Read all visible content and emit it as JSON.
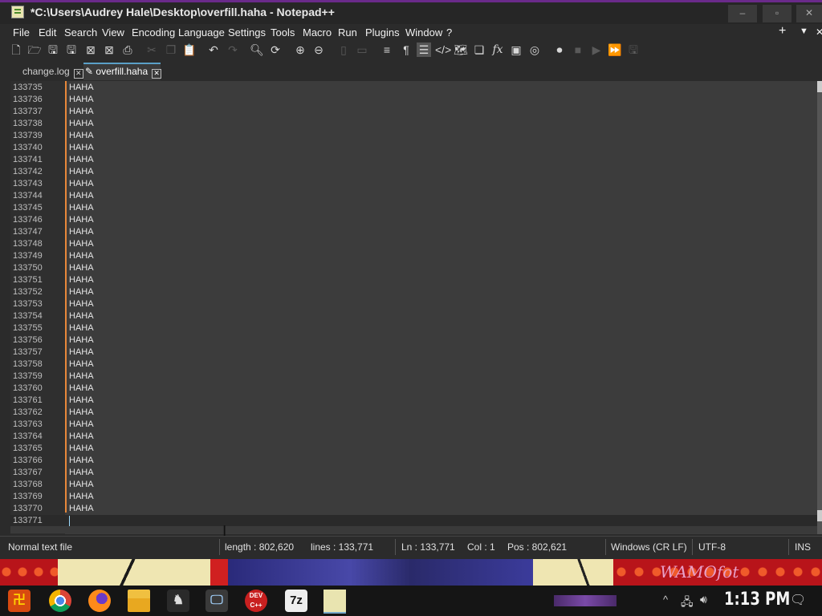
{
  "window": {
    "title": "*C:\\Users\\Audrey Hale\\Desktop\\overfill.haha - Notepad++",
    "controls": {
      "minimize": "–",
      "maximize": "▫",
      "close": "✕"
    }
  },
  "menubar": {
    "items": [
      "File",
      "Edit",
      "Search",
      "View",
      "Encoding",
      "Language",
      "Settings",
      "Tools",
      "Macro",
      "Run",
      "Plugins",
      "Window",
      "?"
    ],
    "right_buttons": {
      "add": "+",
      "list": "▼",
      "close": "✕"
    }
  },
  "toolbar": {
    "icons": [
      "new-file-icon",
      "open-file-icon",
      "save-icon",
      "save-all-icon",
      "close-icon",
      "close-all-icon",
      "print-icon",
      "cut-icon",
      "copy-icon",
      "paste-icon",
      "undo-icon",
      "redo-icon",
      "find-icon",
      "replace-icon",
      "zoom-in-icon",
      "zoom-out-icon",
      "sync-vertical-icon",
      "sync-horizontal-icon",
      "word-wrap-icon",
      "show-all-chars-icon",
      "indent-guide-icon",
      "xml-tag-icon",
      "document-map-icon",
      "document-list-icon",
      "function-list-icon",
      "folder-workspace-icon",
      "monitoring-icon",
      "record-macro-icon",
      "stop-macro-icon",
      "play-macro-icon",
      "run-macro-multiple-icon",
      "save-macro-icon"
    ]
  },
  "tabs": [
    {
      "label": "change.log",
      "active": false,
      "close": "✕"
    },
    {
      "label": "overfill.haha",
      "active": true,
      "close": "✕",
      "modified_icon": "✎"
    }
  ],
  "editor": {
    "lines": [
      {
        "n": "133735",
        "text": "HAHA"
      },
      {
        "n": "133736",
        "text": "HAHA"
      },
      {
        "n": "133737",
        "text": "HAHA"
      },
      {
        "n": "133738",
        "text": "HAHA"
      },
      {
        "n": "133739",
        "text": "HAHA"
      },
      {
        "n": "133740",
        "text": "HAHA"
      },
      {
        "n": "133741",
        "text": "HAHA"
      },
      {
        "n": "133742",
        "text": "HAHA"
      },
      {
        "n": "133743",
        "text": "HAHA"
      },
      {
        "n": "133744",
        "text": "HAHA"
      },
      {
        "n": "133745",
        "text": "HAHA"
      },
      {
        "n": "133746",
        "text": "HAHA"
      },
      {
        "n": "133747",
        "text": "HAHA"
      },
      {
        "n": "133748",
        "text": "HAHA"
      },
      {
        "n": "133749",
        "text": "HAHA"
      },
      {
        "n": "133750",
        "text": "HAHA"
      },
      {
        "n": "133751",
        "text": "HAHA"
      },
      {
        "n": "133752",
        "text": "HAHA"
      },
      {
        "n": "133753",
        "text": "HAHA"
      },
      {
        "n": "133754",
        "text": "HAHA"
      },
      {
        "n": "133755",
        "text": "HAHA"
      },
      {
        "n": "133756",
        "text": "HAHA"
      },
      {
        "n": "133757",
        "text": "HAHA"
      },
      {
        "n": "133758",
        "text": "HAHA"
      },
      {
        "n": "133759",
        "text": "HAHA"
      },
      {
        "n": "133760",
        "text": "HAHA"
      },
      {
        "n": "133761",
        "text": "HAHA"
      },
      {
        "n": "133762",
        "text": "HAHA"
      },
      {
        "n": "133763",
        "text": "HAHA"
      },
      {
        "n": "133764",
        "text": "HAHA"
      },
      {
        "n": "133765",
        "text": "HAHA"
      },
      {
        "n": "133766",
        "text": "HAHA"
      },
      {
        "n": "133767",
        "text": "HAHA"
      },
      {
        "n": "133768",
        "text": "HAHA"
      },
      {
        "n": "133769",
        "text": "HAHA"
      },
      {
        "n": "133770",
        "text": "HAHA"
      },
      {
        "n": "133771",
        "text": ""
      }
    ],
    "colors": {
      "background": "#3c3c3c",
      "gutter": "#2f2f2f",
      "fold_margin": "#e8873a",
      "caret": "#9fdcff"
    }
  },
  "statusbar": {
    "file_type": "Normal text file",
    "length": "length : 802,620",
    "lines": "lines : 133,771",
    "ln": "Ln : 133,771",
    "col": "Col : 1",
    "pos": "Pos : 802,621",
    "eol": "Windows (CR LF)",
    "encoding": "UTF-8",
    "mode": "INS"
  },
  "wallpaper": {
    "text": "WAMOfot"
  },
  "taskbar": {
    "apps": [
      {
        "name": "start-icon",
        "label": ""
      },
      {
        "name": "chrome-icon",
        "label": ""
      },
      {
        "name": "firefox-icon",
        "label": ""
      },
      {
        "name": "file-explorer-icon",
        "label": ""
      },
      {
        "name": "steam-icon",
        "label": ""
      },
      {
        "name": "remote-desktop-icon",
        "label": ""
      },
      {
        "name": "dev-cpp-icon",
        "label": "DEV C++"
      },
      {
        "name": "7zip-icon",
        "label": "7z"
      },
      {
        "name": "notepadpp-taskbar-icon",
        "label": ""
      }
    ],
    "tray": {
      "chevron": "^",
      "clock": "1:13 PM"
    }
  }
}
